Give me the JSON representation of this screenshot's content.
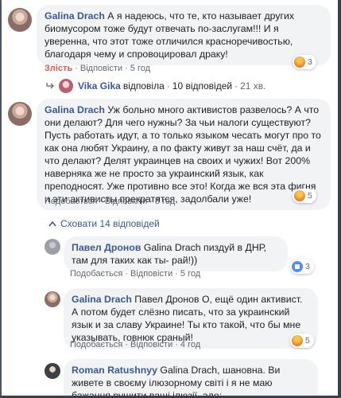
{
  "comment1": {
    "author": "Galina Drach",
    "text": " А я надеюсь, что те, кто называет других биомусором тоже будут отвечать по-заслугам!!! И я уверенна, что этот тоже отличился красноречивостью, благодаря чему и спровоцировал драку!",
    "action_liked": "Злість",
    "action_reply": "Відповісти",
    "time": "5 год",
    "reaction_count": "3",
    "reply_summary": {
      "replier": "Vika Gika",
      "verb": "відповіла",
      "count": "10 відповідей",
      "ago": "21 хв."
    }
  },
  "comment2": {
    "author": "Galina Drach",
    "text": " Уж больно много активистов развелось? А что они делают? Для чего нужны? За чьи налоги существуют? Пусть работать идут, а то только языком чесать могут про то как она любят Украину, а по факту живут за наш счёт, да и что делают? Делят украинцев на своих и чужих! Вот 200% наверняка же не просто за украинский язык, как преподносят. Уже противно все это! Когда же вся эта фигня и эти активисты прекратятся, задолбали уже!",
    "action_like": "Подобається",
    "action_reply": "Відповісти",
    "time": "5 год",
    "reaction_count": "5",
    "hide_replies": "Сховати 14 відповідей"
  },
  "reply1": {
    "author": "Павел Дронов",
    "text": " Galina Drach пиздуй в ДНР, там для таких как ты- рай!))",
    "action_like": "Подобається",
    "action_reply": "Відповісти",
    "time": "5 год",
    "reaction_count": "3"
  },
  "reply2": {
    "author": "Galina Drach",
    "text": " Павел Дронов О, ещё один активист. А потом будет слёзно писать, что за украинский язык и за славу Украине! Ты кто такой, что бы мне указывать, говнюк сраный!",
    "action_like": "Подобається",
    "action_reply": "Відповісти",
    "time": "4 год",
    "reaction_count": "5"
  },
  "reply3": {
    "author": "Roman Ratushnyy",
    "text": " Galina Drach, шановна. Ви живете в своєму ілюзорному світі і я не маю бажання рушити ваші ілюзії. але:"
  },
  "colors": {
    "link": "#385898",
    "bubble_bg": "#f2f3f5",
    "meta": "#606770",
    "angry": "#e0574a"
  }
}
